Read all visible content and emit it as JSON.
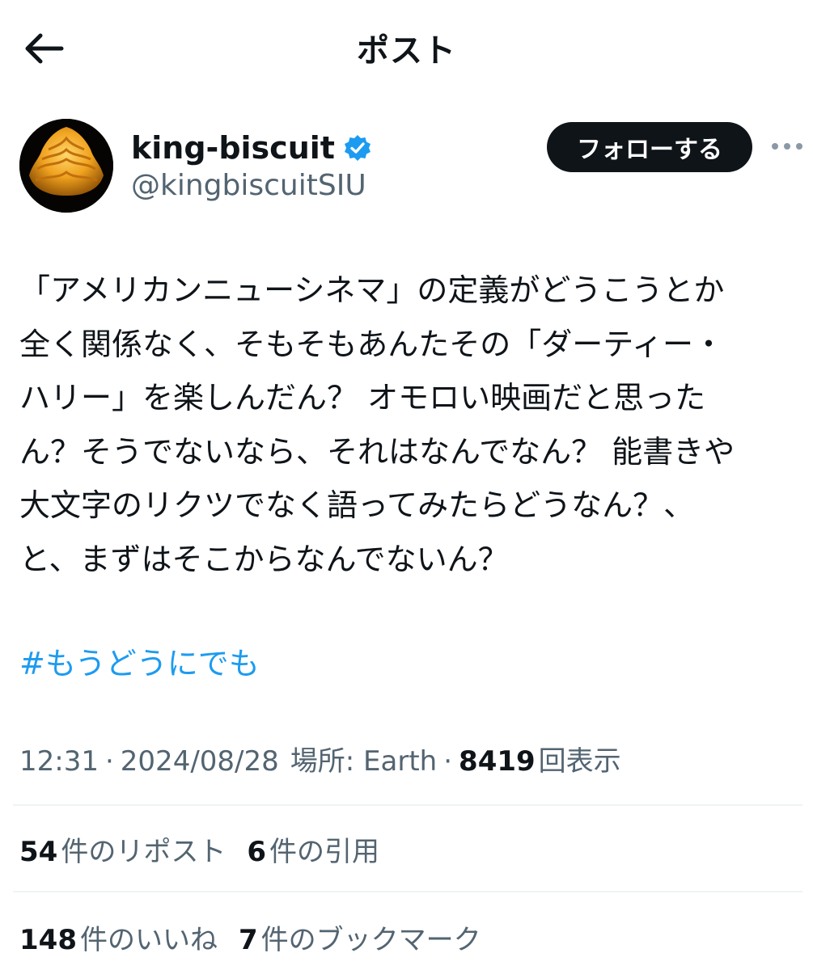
{
  "header": {
    "title": "ポスト",
    "back_icon": "arrow-left-icon"
  },
  "author": {
    "display_name": "king-biscuit",
    "handle": "@kingbiscuitSIU",
    "verified_icon": "verified-badge-icon",
    "follow_label": "フォローする",
    "more_icon": "more-horizontal-icon"
  },
  "post": {
    "text": "「アメリカンニューシネマ」の定義がどうこうとか\n全く関係なく、そもそもあんたその「ダーティー・\nハリー」を楽しんだん？ オモロい映画だと思った\nん？そうでないなら、それはなんでなん？ 能書きや\n大文字のリクツでなく語ってみたらどうなん？、\nと、まずはそこからなんでないん？",
    "hashtag": "#もうどうにでも"
  },
  "meta": {
    "time": "12:31",
    "separator": "·",
    "date": "2024/08/28",
    "location": "場所: Earth",
    "views_count": "8419",
    "views_label": "回表示"
  },
  "stats": {
    "reposts_count": "54",
    "reposts_label": "件のリポスト",
    "quotes_count": "6",
    "quotes_label": "件の引用",
    "likes_count": "148",
    "likes_label": "件のいいね",
    "bookmarks_count": "7",
    "bookmarks_label": "件のブックマーク"
  },
  "colors": {
    "text": "#0f1419",
    "secondary": "#536471",
    "link": "#1d9bf0",
    "follow_bg": "#0f1419",
    "divider": "#eff3f4"
  }
}
